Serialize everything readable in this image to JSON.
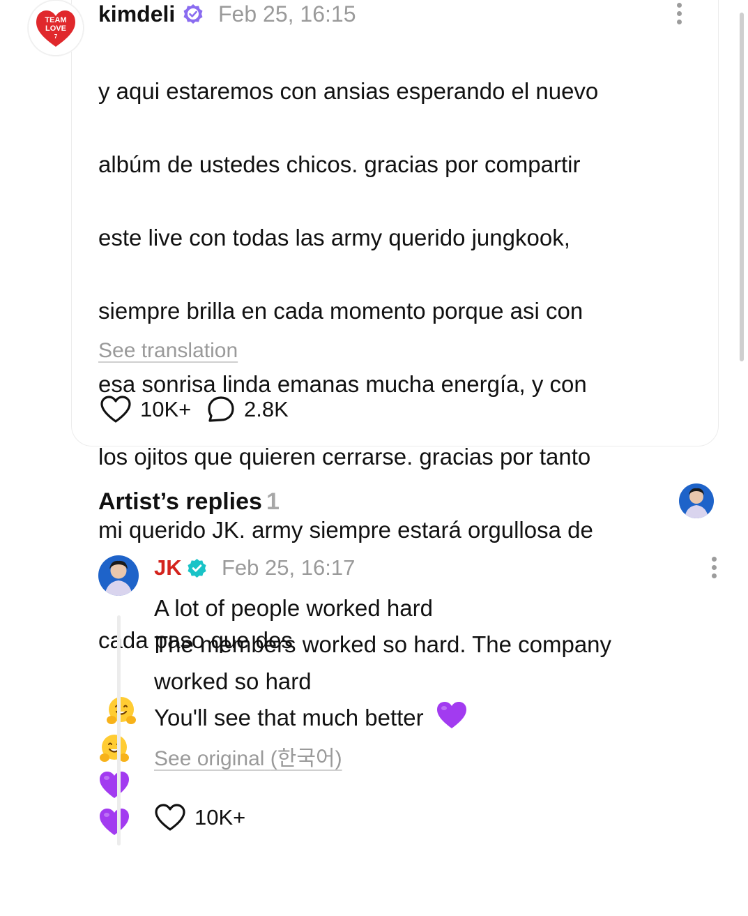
{
  "post": {
    "username": "kimdeli",
    "avatar_text": [
      "TEAM",
      "LOVE",
      "7"
    ],
    "time": "Feb 25, 16:15",
    "body_lines": [
      "y aqui estaremos con ansias esperando el nuevo",
      "albúm de ustedes chicos. gracias por compartir",
      "este live con todas las army querido jungkook,",
      "siempre brilla en cada momento porque asi con",
      "esa sonrisa linda emanas mucha energía, y con",
      "los ojitos que quieren cerrarse. gracias por tanto",
      "mi querido JK. army siempre estará orgullosa de",
      "cada paso que des"
    ],
    "trailing_emoji": [
      "hugging-face",
      "hugging-face",
      "purple-heart",
      "purple-heart"
    ],
    "see_translation": "See translation",
    "likes": "10K+",
    "comments": "2.8K"
  },
  "artist_replies": {
    "title": "Artist’s replies",
    "count": "1"
  },
  "reply": {
    "username": "JK",
    "time": "Feb 25, 16:17",
    "body_lines": [
      "A lot of people worked hard",
      "The members worked so hard. The company",
      "worked so hard",
      "You'll see that much better"
    ],
    "trailing_emoji": [
      "purple-heart"
    ],
    "see_original": "See original",
    "language": "(한국어)",
    "likes": "10K+"
  },
  "colors": {
    "artist_name": "#d4231d",
    "verified_purple": "#8a6cf0",
    "verified_teal": "#19c3c7",
    "muted_text": "#9a9a9a",
    "purple_heart": "#a23bf0"
  }
}
